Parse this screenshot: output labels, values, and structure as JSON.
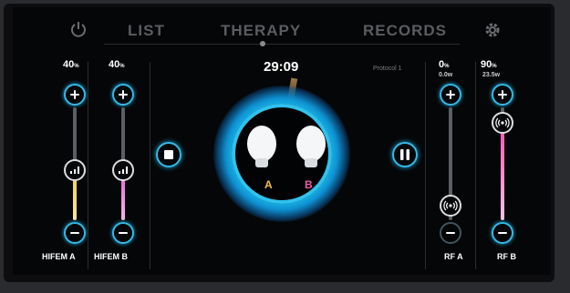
{
  "nav": {
    "list": "LIST",
    "therapy": "THERAPY",
    "records": "RECORDS",
    "power_icon": "power-icon",
    "settings_icon": "gear-icon"
  },
  "center": {
    "timer": "29:09",
    "label_a": "A",
    "label_b": "B",
    "color_a": "#f3c13b",
    "color_b": "#ea5aa7",
    "glow_color": "#1ab8e8"
  },
  "channels": {
    "hifem_a": {
      "label": "HIFEM A",
      "percent": "40",
      "unit": "%",
      "level": 0.4,
      "fill_color": "#f1d34a"
    },
    "hifem_b": {
      "label": "HIFEM B",
      "percent": "40",
      "unit": "%",
      "level": 0.4,
      "fill_color": "#e76ad6"
    },
    "rf_a": {
      "label": "RF A",
      "percent": "0",
      "unit": "%",
      "power": "0.0",
      "power_unit": "w",
      "level": 0.0,
      "fill_color": "#8d8f93"
    },
    "rf_b": {
      "label": "RF B",
      "percent": "90",
      "unit": "%",
      "power": "23.5",
      "power_unit": "w",
      "level": 0.9,
      "fill_color": "#ff59b8"
    }
  },
  "protocol": "Protocol 1",
  "accent_color": "#35b9e6"
}
